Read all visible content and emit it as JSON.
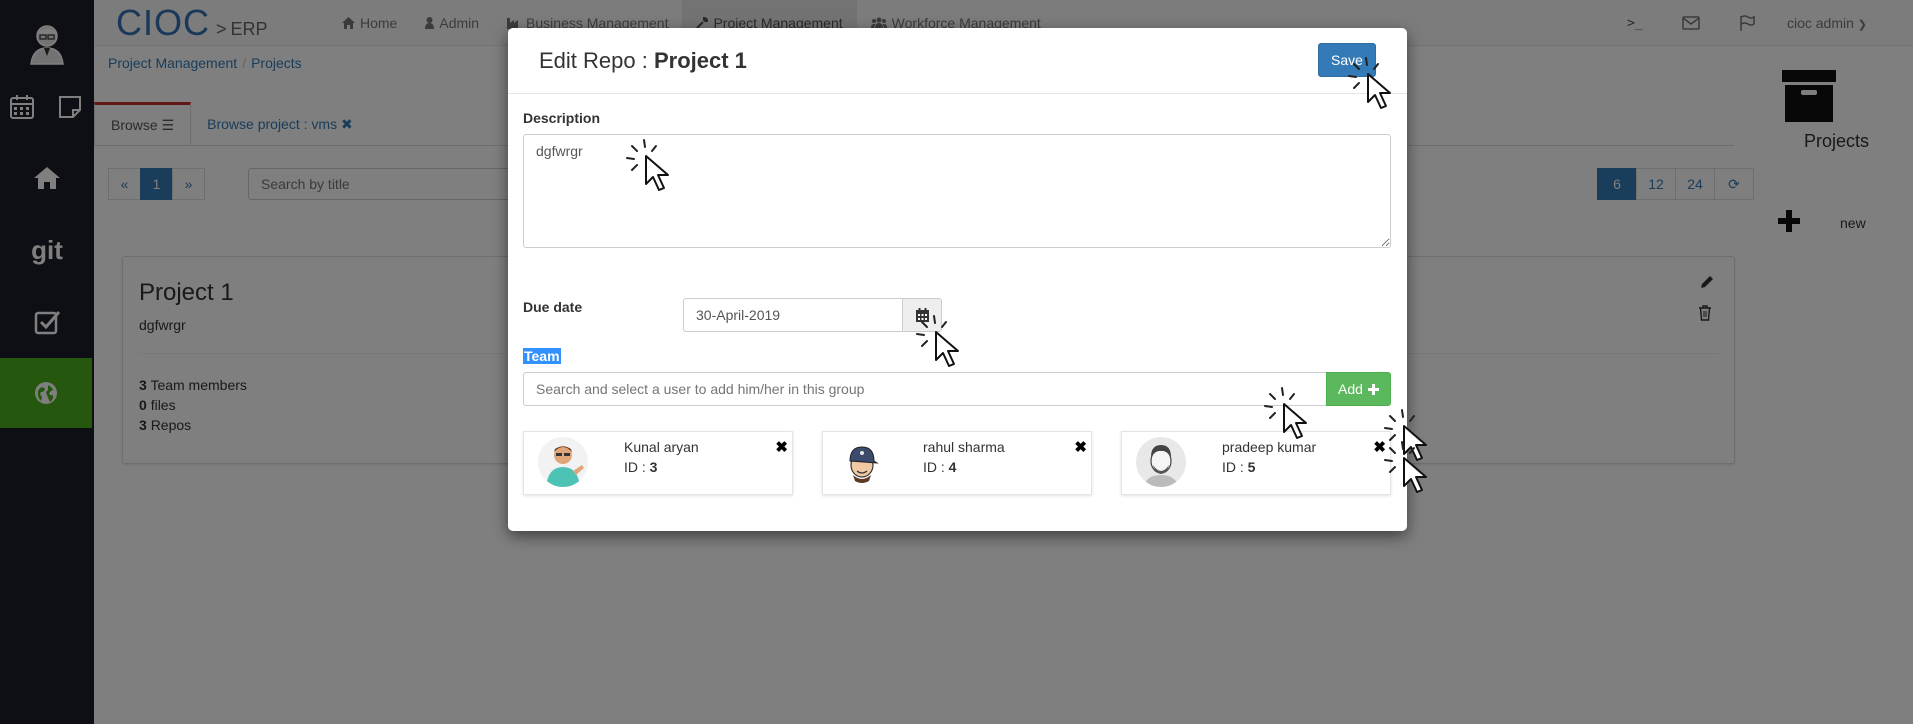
{
  "brand": {
    "logo": "CIOC",
    "separator": ">",
    "suffix": "ERP"
  },
  "nav": {
    "items": [
      {
        "label": "Home",
        "icon": "home-icon"
      },
      {
        "label": "Admin",
        "icon": "user-icon"
      },
      {
        "label": "Business Management",
        "icon": "industry-icon"
      },
      {
        "label": "Project Management",
        "icon": "wrench-icon",
        "active": true
      },
      {
        "label": "Workforce Management",
        "icon": "users-icon"
      }
    ],
    "terminal_label": ">_",
    "user": "cioc admin"
  },
  "breadcrumb": {
    "level1": "Project Management",
    "level2": "Projects"
  },
  "tabs": {
    "browse": "Browse",
    "browse_project": "Browse project : vms"
  },
  "pager": {
    "prev": "«",
    "current": "1",
    "next": "»"
  },
  "search": {
    "placeholder": "Search by title"
  },
  "page_sizes": [
    "6",
    "12",
    "24"
  ],
  "card": {
    "title": "Project 1",
    "description": "dgfwrgr",
    "team_count": "3",
    "team_label": "Team members",
    "files_count": "0",
    "files_label": "files",
    "repos_count": "3",
    "repos_label": "Repos"
  },
  "right_panel": {
    "title": "Projects",
    "new_label": "new"
  },
  "modal": {
    "title_prefix": "Edit Repo : ",
    "title_name": "Project 1",
    "save_label": "Save",
    "description_label": "Description",
    "description_value": "dgfwrgr",
    "due_date_label": "Due date",
    "due_date_value": "30-April-2019",
    "team_label": "Team",
    "team_placeholder": "Search and select a user to add him/her in this group",
    "add_label": "Add",
    "members": [
      {
        "name": "Kunal aryan",
        "id_label": "ID : ",
        "id": "3"
      },
      {
        "name": "rahul sharma",
        "id_label": "ID : ",
        "id": "4"
      },
      {
        "name": "pradeep kumar",
        "id_label": "ID : ",
        "id": "5"
      }
    ]
  },
  "colors": {
    "sidebar": "#1c1e2b",
    "sidebar_active": "#4cae1c",
    "primary": "#337ab7",
    "success": "#5cb85c",
    "brand": "#3470b3"
  }
}
